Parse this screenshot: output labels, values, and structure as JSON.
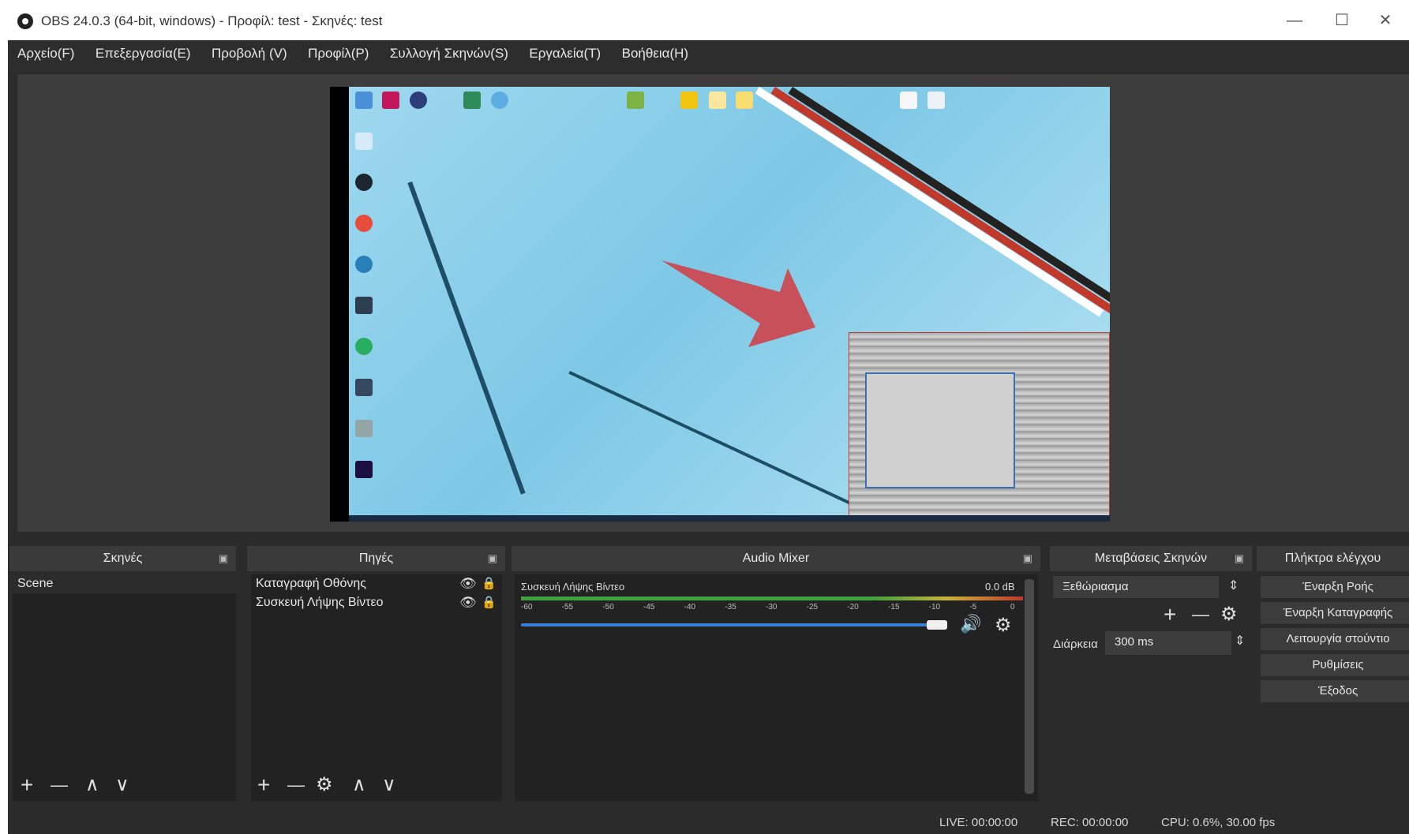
{
  "window": {
    "title": "OBS 24.0.3 (64-bit, windows) - Προφίλ: test - Σκηνές: test",
    "minimize": "—",
    "maximize": "☐",
    "close": "✕"
  },
  "menu": [
    "Αρχείο(F)",
    "Επεξεργασία(E)",
    "Προβολή (V)",
    "Προφίλ(P)",
    "Συλλογή Σκηνών(S)",
    "Εργαλεία(T)",
    "Βοήθεια(H)"
  ],
  "scenes": {
    "title": "Σκηνές",
    "items": [
      "Scene"
    ],
    "toolbar": {
      "add": "+",
      "remove": "—",
      "up": "∧",
      "down": "∨"
    }
  },
  "sources": {
    "title": "Πηγές",
    "items": [
      "Καταγραφή Οθόνης",
      "Συσκευή Λήψης Βίντεο"
    ],
    "toolbar": {
      "add": "+",
      "remove": "—",
      "settings": "⚙",
      "up": "∧",
      "down": "∨"
    }
  },
  "mixer": {
    "title": "Audio Mixer",
    "channel_name": "Συσκευή Λήψης Βίντεο",
    "level": "0.0 dB",
    "scale": [
      "-60",
      "-55",
      "-50",
      "-45",
      "-40",
      "-35",
      "-30",
      "-25",
      "-20",
      "-15",
      "-10",
      "-5",
      "0"
    ],
    "volume_fraction": 1.0
  },
  "transitions": {
    "title": "Μεταβάσεις Σκηνών",
    "selected": "Ξεθώριασμα",
    "duration_label": "Διάρκεια",
    "duration_value": "300 ms"
  },
  "controls": {
    "title": "Πλήκτρα ελέγχου",
    "buttons": [
      "Έναρξη Ροής",
      "Έναρξη Καταγραφής",
      "Λειτουργία στούντιο",
      "Ρυθμίσεις",
      "Έξοδος"
    ]
  },
  "status": {
    "live": "LIVE: 00:00:00",
    "rec": "REC: 00:00:00",
    "cpu": "CPU: 0.6%, 30.00 fps"
  },
  "colors": {
    "accent": "#3a7bd5",
    "panel": "#222222",
    "dock_header": "#3a3a3a",
    "background": "#2b2b2b"
  }
}
